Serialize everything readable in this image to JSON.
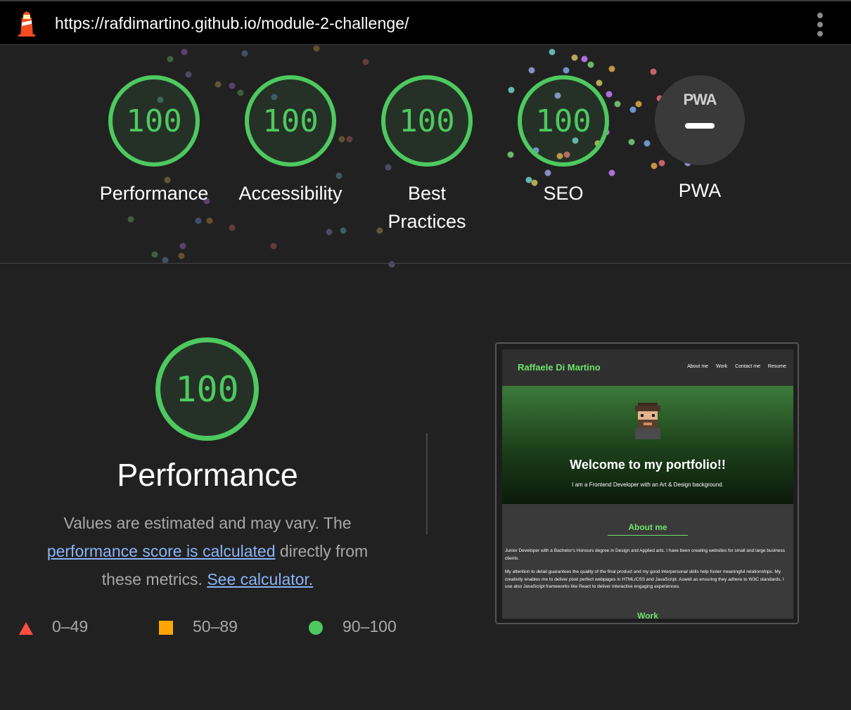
{
  "topbar": {
    "url": "https://rafdimartino.github.io/module-2-challenge/",
    "logo_icon": "lighthouse-icon",
    "menu_icon": "more-vert-icon"
  },
  "categories": [
    {
      "score": "100",
      "label_lines": [
        "Performance"
      ]
    },
    {
      "score": "100",
      "label_lines": [
        "Accessibility"
      ]
    },
    {
      "score": "100",
      "label_lines": [
        "Best",
        "Practices"
      ]
    },
    {
      "score": "100",
      "label_lines": [
        "SEO"
      ]
    },
    {
      "badge": "PWA",
      "label_lines": [
        "PWA"
      ]
    }
  ],
  "colors": {
    "pass": "#4ec95f",
    "average": "#ffa400",
    "fail": "#ff4e42",
    "link": "#8ab4f8"
  },
  "performance": {
    "score": "100",
    "title": "Performance",
    "desc_part1": "Values are estimated and may vary. The ",
    "desc_link1": "performance score is calculated",
    "desc_part2": " directly from these metrics. ",
    "desc_link2": "See calculator."
  },
  "legend": [
    {
      "shape": "triangle",
      "range": "0–49"
    },
    {
      "shape": "square",
      "range": "50–89"
    },
    {
      "shape": "circle",
      "range": "90–100"
    }
  ],
  "screenshot": {
    "brand": "Raffaele Di Martino",
    "nav": [
      "About me",
      "Work",
      "Contact me",
      "Resume"
    ],
    "hero_title": "Welcome to my portfolio!!",
    "hero_sub": "I am a Frontend Developer with an Art & Design background.",
    "about_title": "About me",
    "about_p1": "Junior Developer with a Bachelor's Honours degree in Design and Applied arts. I have been creating websites for small and large business clients.",
    "about_p2": "My attention to detail guarantees the quality of the final product and my good interpersonal skills help foster meaningful relationships. My creativity enables me to deliver pixel perfect webpages in HTML/CSS and JavaScript. Aswell as ensuring they adhere to W3C standards, I use also JavaScript frameworks like React to deliver interactive engaging experiences.",
    "work_title": "Work"
  }
}
